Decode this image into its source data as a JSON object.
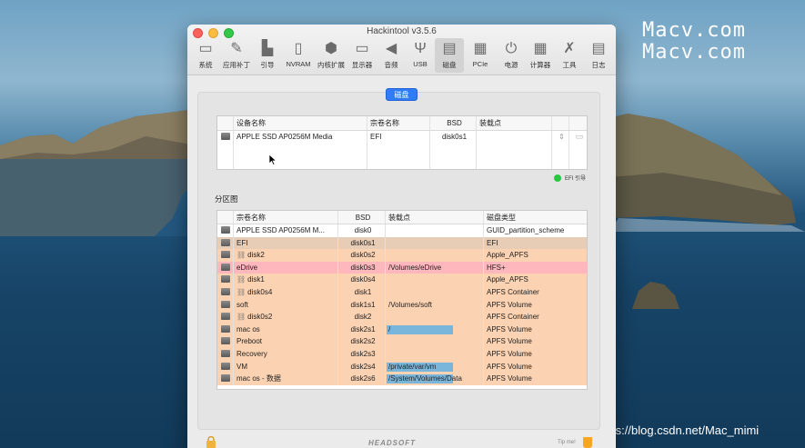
{
  "desktop": {
    "watermark": [
      "Macv.com",
      "Macv.com"
    ],
    "csdn": "https://blog.csdn.net/Mac_mimi"
  },
  "window": {
    "title": "Hackintool v3.5.6",
    "toolbar": [
      {
        "label": "系统",
        "icon": "system-icon"
      },
      {
        "label": "应用补丁",
        "icon": "patch-icon"
      },
      {
        "label": "引导",
        "icon": "boot-icon"
      },
      {
        "label": "NVRAM",
        "icon": "nvram-icon"
      },
      {
        "label": "内核扩展",
        "icon": "kext-icon"
      },
      {
        "label": "显示器",
        "icon": "display-icon"
      },
      {
        "label": "音频",
        "icon": "audio-icon"
      },
      {
        "label": "USB",
        "icon": "usb-icon"
      },
      {
        "label": "磁盘",
        "icon": "disk-icon",
        "active": true
      },
      {
        "label": "PCIe",
        "icon": "pcie-icon"
      },
      {
        "label": "电源",
        "icon": "power-icon"
      },
      {
        "label": "计算器",
        "icon": "calculator-icon"
      },
      {
        "label": "工具",
        "icon": "tools-icon"
      },
      {
        "label": "日志",
        "icon": "log-icon"
      }
    ],
    "tab": "磁盘",
    "disk_table": {
      "headers": [
        "设备名称",
        "宗卷名称",
        "BSD",
        "装载点"
      ],
      "rows": [
        {
          "device": "APPLE SSD AP0256M Media",
          "volume": "EFI",
          "bsd": "disk0s1",
          "mount": ""
        }
      ]
    },
    "efi_legend": "EFI 引导",
    "partition_section": "分区图",
    "partition_table": {
      "headers": [
        "宗卷名称",
        "BSD",
        "装载点",
        "磁盘类型"
      ],
      "rows": [
        {
          "name": "APPLE SSD AP0256M M...",
          "bsd": "disk0",
          "mount": "",
          "type": "GUID_partition_scheme",
          "color": "#ffffff",
          "link": false,
          "fill": 0
        },
        {
          "name": "EFI",
          "bsd": "disk0s1",
          "mount": "",
          "type": "EFI",
          "color": "#e8cdb6",
          "link": false,
          "fill": 0
        },
        {
          "name": "disk2",
          "bsd": "disk0s2",
          "mount": "",
          "type": "Apple_APFS",
          "color": "#fcd3b2",
          "link": true,
          "fill": 0
        },
        {
          "name": "eDrive",
          "bsd": "disk0s3",
          "mount": "/Volumes/eDrive",
          "type": "HFS+",
          "color": "#fdb7bd",
          "link": false,
          "fill": 0
        },
        {
          "name": "disk1",
          "bsd": "disk0s4",
          "mount": "",
          "type": "Apple_APFS",
          "color": "#fcd3b2",
          "link": true,
          "fill": 0
        },
        {
          "name": "disk0s4",
          "bsd": "disk1",
          "mount": "",
          "type": "APFS Container",
          "color": "#fcd3b2",
          "link": true,
          "fill": 0
        },
        {
          "name": "soft",
          "bsd": "disk1s1",
          "mount": "/Volumes/soft",
          "type": "APFS Volume",
          "color": "#fcd3b2",
          "link": false,
          "fill": 0
        },
        {
          "name": "disk0s2",
          "bsd": "disk2",
          "mount": "",
          "type": "APFS Container",
          "color": "#fcd3b2",
          "link": true,
          "fill": 0
        },
        {
          "name": "mac os",
          "bsd": "disk2s1",
          "mount": "/",
          "type": "APFS Volume",
          "color": "#fcd3b2",
          "link": false,
          "fill": 0.68
        },
        {
          "name": "Preboot",
          "bsd": "disk2s2",
          "mount": "",
          "type": "APFS Volume",
          "color": "#fcd3b2",
          "link": false,
          "fill": 0
        },
        {
          "name": "Recovery",
          "bsd": "disk2s3",
          "mount": "",
          "type": "APFS Volume",
          "color": "#fcd3b2",
          "link": false,
          "fill": 0
        },
        {
          "name": "VM",
          "bsd": "disk2s4",
          "mount": "/private/var/vm",
          "type": "APFS Volume",
          "color": "#fcd3b2",
          "link": false,
          "fill": 0.68
        },
        {
          "name": "mac os - 数据",
          "bsd": "disk2s6",
          "mount": "/System/Volumes/Data",
          "type": "APFS Volume",
          "color": "#fcd3b2",
          "link": false,
          "fill": 0.68
        }
      ]
    },
    "footer": {
      "logo": "HEADSOFT",
      "tip": "Tip me!"
    }
  }
}
